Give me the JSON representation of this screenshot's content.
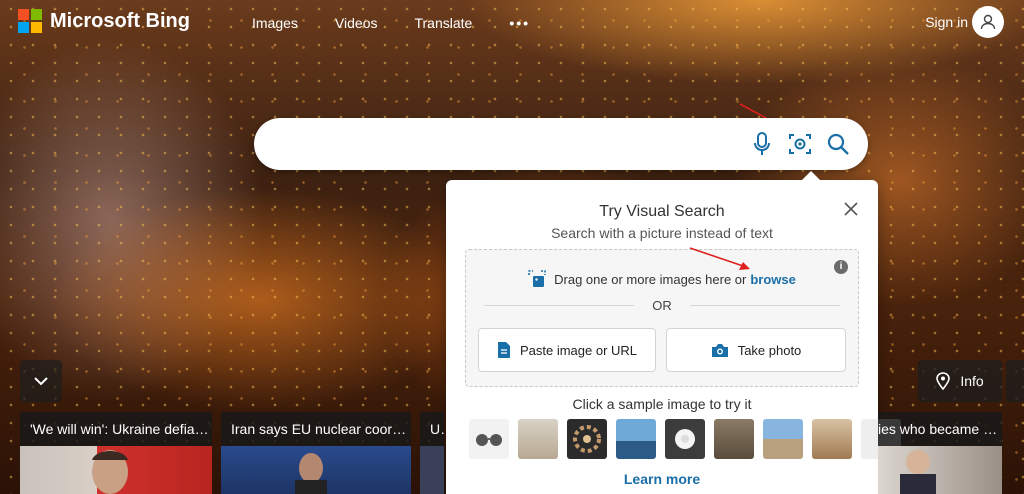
{
  "header": {
    "logo_text": "Microsoft Bing",
    "nav": [
      "Images",
      "Videos",
      "Translate"
    ],
    "more": "•••",
    "signin": "Sign in"
  },
  "search": {
    "value": "",
    "icons": [
      "microphone-icon",
      "visual-search-icon",
      "search-icon"
    ]
  },
  "visual_search": {
    "title": "Try Visual Search",
    "subtitle": "Search with a picture instead of text",
    "drag_text": "Drag one or more images here or",
    "browse": "browse",
    "or": "OR",
    "paste_label": "Paste image or URL",
    "photo_label": "Take photo",
    "sample_title": "Click a sample image to try it",
    "learn_more": "Learn more"
  },
  "bottom": {
    "info_label": "Info"
  },
  "news": [
    {
      "caption": "'We will win': Ukraine defia…"
    },
    {
      "caption": "Iran says EU nuclear coordi…"
    },
    {
      "caption": "Uk"
    },
    {
      "caption": "ies who became m…"
    }
  ],
  "colors": {
    "accent_link": "#1a6fa8",
    "ms_red": "#f25022",
    "ms_green": "#7fba00",
    "ms_blue": "#00a4ef",
    "ms_yellow": "#ffb900"
  }
}
